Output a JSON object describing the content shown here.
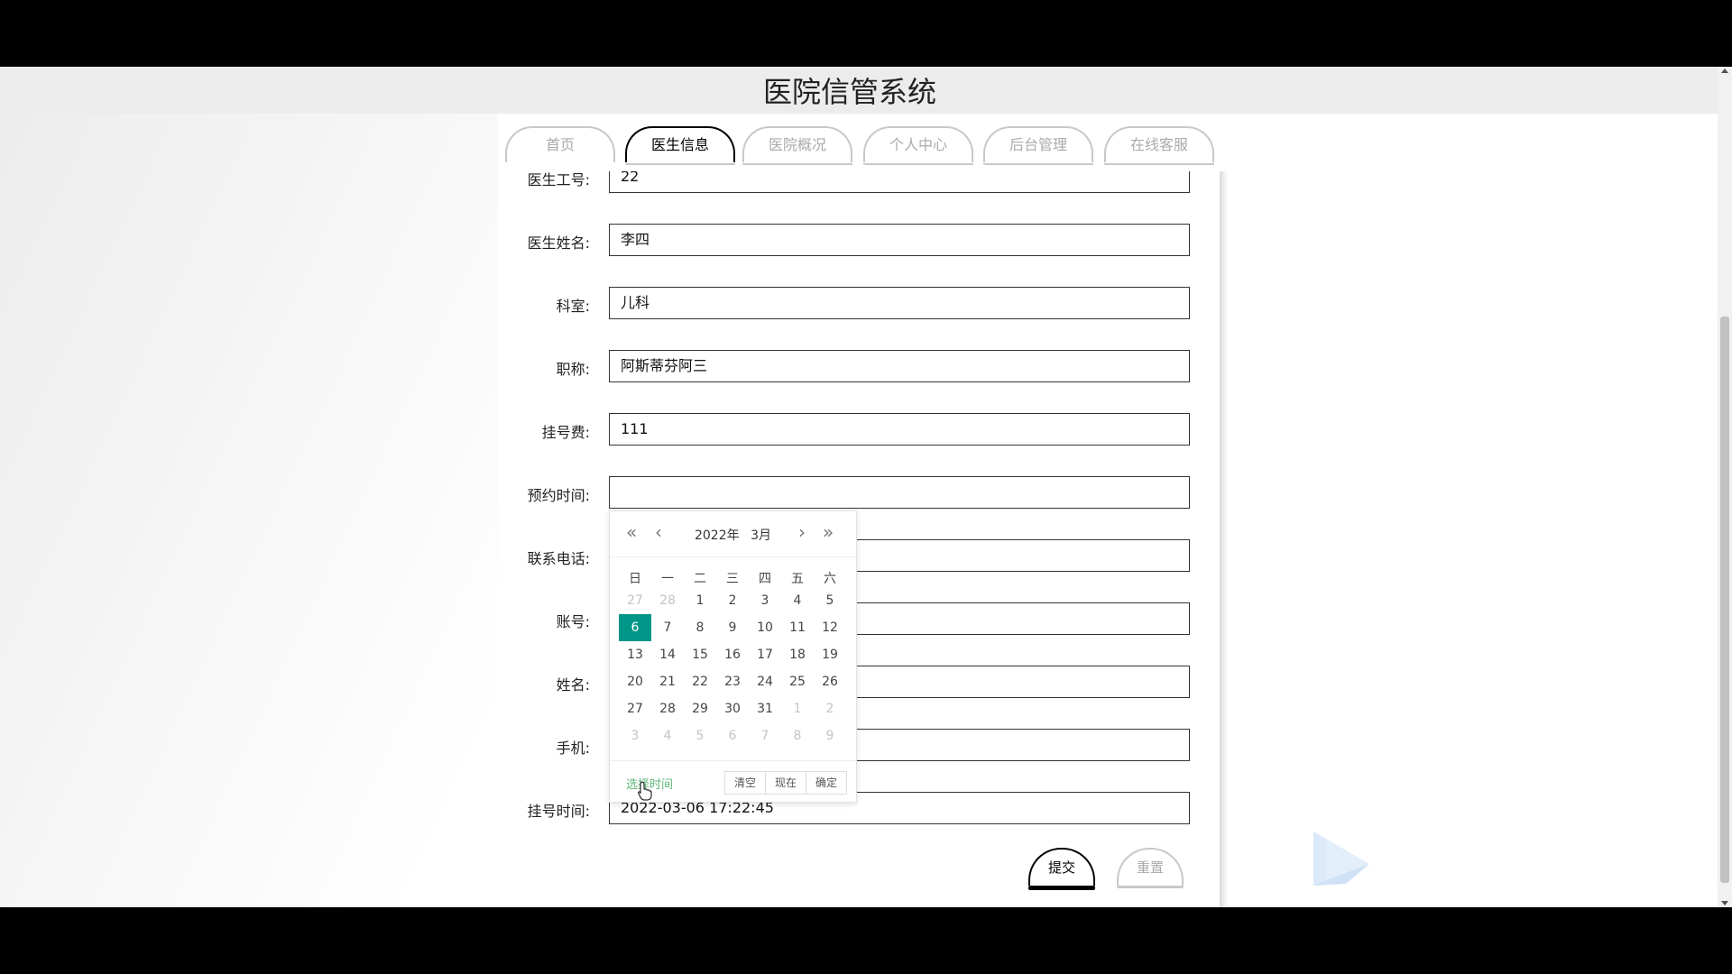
{
  "site": {
    "title": "医院信管系统"
  },
  "nav": {
    "tabs": [
      {
        "label": "首页",
        "active": false
      },
      {
        "label": "医生信息",
        "active": true
      },
      {
        "label": "医院概况",
        "active": false
      },
      {
        "label": "个人中心",
        "active": false
      },
      {
        "label": "后台管理",
        "active": false
      },
      {
        "label": "在线客服",
        "active": false
      }
    ]
  },
  "form": {
    "fields": [
      {
        "label": "医生工号:",
        "value": "22"
      },
      {
        "label": "医生姓名:",
        "value": "李四"
      },
      {
        "label": "科室:",
        "value": "儿科"
      },
      {
        "label": "职称:",
        "value": "阿斯蒂芬阿三"
      },
      {
        "label": "挂号费:",
        "value": "111"
      },
      {
        "label": "预约时间:",
        "value": ""
      },
      {
        "label": "联系电话:",
        "value": ""
      },
      {
        "label": "账号:",
        "value": ""
      },
      {
        "label": "姓名:",
        "value": ""
      },
      {
        "label": "手机:",
        "value": ""
      },
      {
        "label": "挂号时间:",
        "value": "2022-03-06 17:22:45"
      }
    ],
    "submit_label": "提交",
    "reset_label": "重置"
  },
  "datepicker": {
    "year": "2022年",
    "month": "3月",
    "weekdays": [
      "日",
      "一",
      "二",
      "三",
      "四",
      "五",
      "六"
    ],
    "weeks": [
      [
        "27",
        "28",
        "1",
        "2",
        "3",
        "4",
        "5"
      ],
      [
        "6",
        "7",
        "8",
        "9",
        "10",
        "11",
        "12"
      ],
      [
        "13",
        "14",
        "15",
        "16",
        "17",
        "18",
        "19"
      ],
      [
        "20",
        "21",
        "22",
        "23",
        "24",
        "25",
        "26"
      ],
      [
        "27",
        "28",
        "29",
        "30",
        "31",
        "1",
        "2"
      ],
      [
        "3",
        "4",
        "5",
        "6",
        "7",
        "8",
        "9"
      ]
    ],
    "selected_day": "6",
    "choose_time_label": "选择时间",
    "clear_label": "清空",
    "now_label": "现在",
    "confirm_label": "确定",
    "selected_color": "#009688",
    "link_color": "#5fb878"
  }
}
